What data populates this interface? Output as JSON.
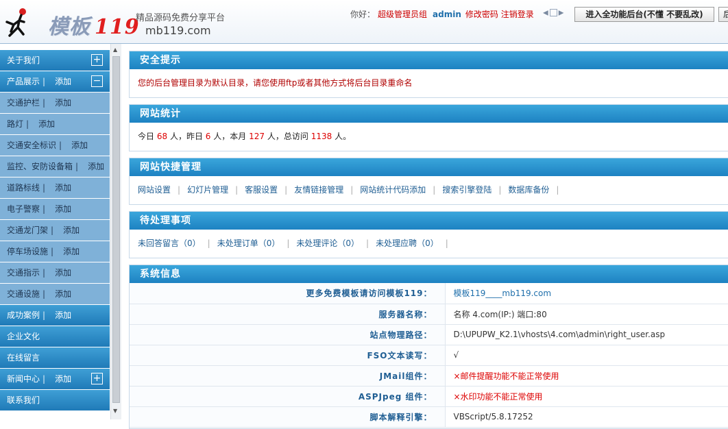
{
  "header": {
    "logo_cn": "模板",
    "logo_num": "119",
    "slogan": "精品源码免费分享平台",
    "domain": "mb119.com",
    "greeting": "你好：",
    "role": "超级管理员组",
    "username": "admin",
    "change_password": "修改密码",
    "logout": "注销登录",
    "full_admin_button": "进入全功能后台(不懂 不要乱改)",
    "other_button": "后"
  },
  "sidebar": {
    "items": [
      {
        "label": "关于我们",
        "type": "main",
        "add": "",
        "toggle": "+"
      },
      {
        "label": "产品展示",
        "type": "main",
        "add": "添加",
        "toggle": "−"
      },
      {
        "label": "交通护栏",
        "type": "sub",
        "add": "添加",
        "toggle": ""
      },
      {
        "label": "路灯",
        "type": "sub",
        "add": "添加",
        "toggle": ""
      },
      {
        "label": "交通安全标识",
        "type": "sub",
        "add": "添加",
        "toggle": ""
      },
      {
        "label": "监控、安防设备箱",
        "type": "sub",
        "add": "添加",
        "toggle": ""
      },
      {
        "label": "道路标线",
        "type": "sub",
        "add": "添加",
        "toggle": ""
      },
      {
        "label": "电子警察",
        "type": "sub",
        "add": "添加",
        "toggle": ""
      },
      {
        "label": "交通龙门架",
        "type": "sub",
        "add": "添加",
        "toggle": ""
      },
      {
        "label": "停车场设施",
        "type": "sub",
        "add": "添加",
        "toggle": ""
      },
      {
        "label": "交通指示",
        "type": "sub",
        "add": "添加",
        "toggle": ""
      },
      {
        "label": "交通设施",
        "type": "sub",
        "add": "添加",
        "toggle": ""
      },
      {
        "label": "成功案例",
        "type": "main",
        "add": "添加",
        "toggle": ""
      },
      {
        "label": "企业文化",
        "type": "main",
        "add": "",
        "toggle": ""
      },
      {
        "label": "在线留言",
        "type": "main",
        "add": "",
        "toggle": ""
      },
      {
        "label": "新闻中心",
        "type": "main",
        "add": "添加",
        "toggle": "+"
      },
      {
        "label": "联系我们",
        "type": "main",
        "add": "",
        "toggle": ""
      }
    ]
  },
  "security": {
    "title": "安全提示",
    "message": "您的后台管理目录为默认目录，请您使用ftp或者其他方式将后台目录重命名"
  },
  "stats": {
    "title": "网站统计",
    "today_label": "今日",
    "today": "68",
    "yesterday_label": "人，昨日",
    "yesterday": "6",
    "month_label": "人，本月",
    "month": "127",
    "total_label": "人，总访问",
    "total": "1138",
    "end": "人。"
  },
  "quick": {
    "title": "网站快捷管理",
    "links": [
      "网站设置",
      "幻灯片管理",
      "客服设置",
      "友情链接管理",
      "网站统计代码添加",
      "搜索引擎登陆",
      "数据库备份"
    ]
  },
  "todo": {
    "title": "待处理事项",
    "items": [
      "未回答留言（0）",
      "未处理订单（0）",
      "未处理评论（0）",
      "未处理应聘（0）"
    ]
  },
  "sysinfo": {
    "title": "系统信息",
    "rows": [
      {
        "key": "更多免费模板请访问模板119：",
        "value": "模板119____mb119.com"
      },
      {
        "key": "服务器名称：",
        "value": "名称 4.com(IP:) 端口:80"
      },
      {
        "key": "站点物理路径：",
        "value": "D:\\UPUPW_K2.1\\vhosts\\4.com\\admin\\right_user.asp"
      },
      {
        "key": "FSO文本读写：",
        "value": "√"
      },
      {
        "key": "JMail组件：",
        "value": "×邮件提醒功能不能正常使用"
      },
      {
        "key": "ASPJpeg 组件：",
        "value": "×水印功能不能正常使用"
      },
      {
        "key": "脚本解释引擎：",
        "value": "VBScript/5.8.17252"
      }
    ]
  },
  "colors": {
    "accent": "#1d82c2",
    "sidebar_sub": "#7fb1d8",
    "warning": "#b00000",
    "number": "#dd0000"
  }
}
